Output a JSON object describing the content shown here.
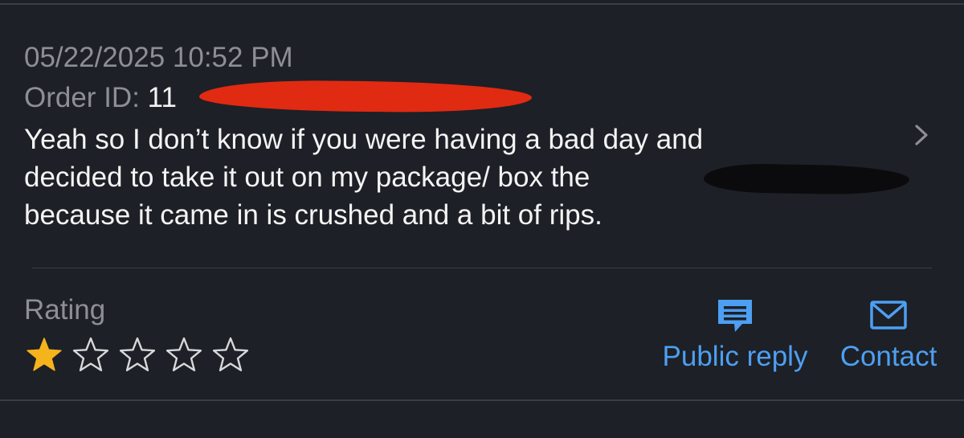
{
  "review": {
    "date": "05/22/2025 10:52 PM",
    "order_label": "Order ID:",
    "order_value_visible": "11",
    "text_lines": [
      "Yeah so I don’t know if you were having a bad day and",
      "decided to take it out on my package/ box the",
      "because it came in is crushed and a bit of rips."
    ],
    "chevron_icon": "chevron-right-icon"
  },
  "rating": {
    "label": "Rating",
    "value": 1,
    "max": 5,
    "filled_color": "#f5b31c",
    "empty_color": "#d7d8da"
  },
  "actions": {
    "public_reply": {
      "label": "Public reply",
      "icon": "chat-bubble-icon"
    },
    "contact": {
      "label": "Contact",
      "icon": "envelope-icon"
    }
  },
  "colors": {
    "background": "#1d2026",
    "muted_text": "#8d8f95",
    "primary_text": "#f4f4f4",
    "accent": "#4d9ff2",
    "divider": "#3a3d44"
  }
}
